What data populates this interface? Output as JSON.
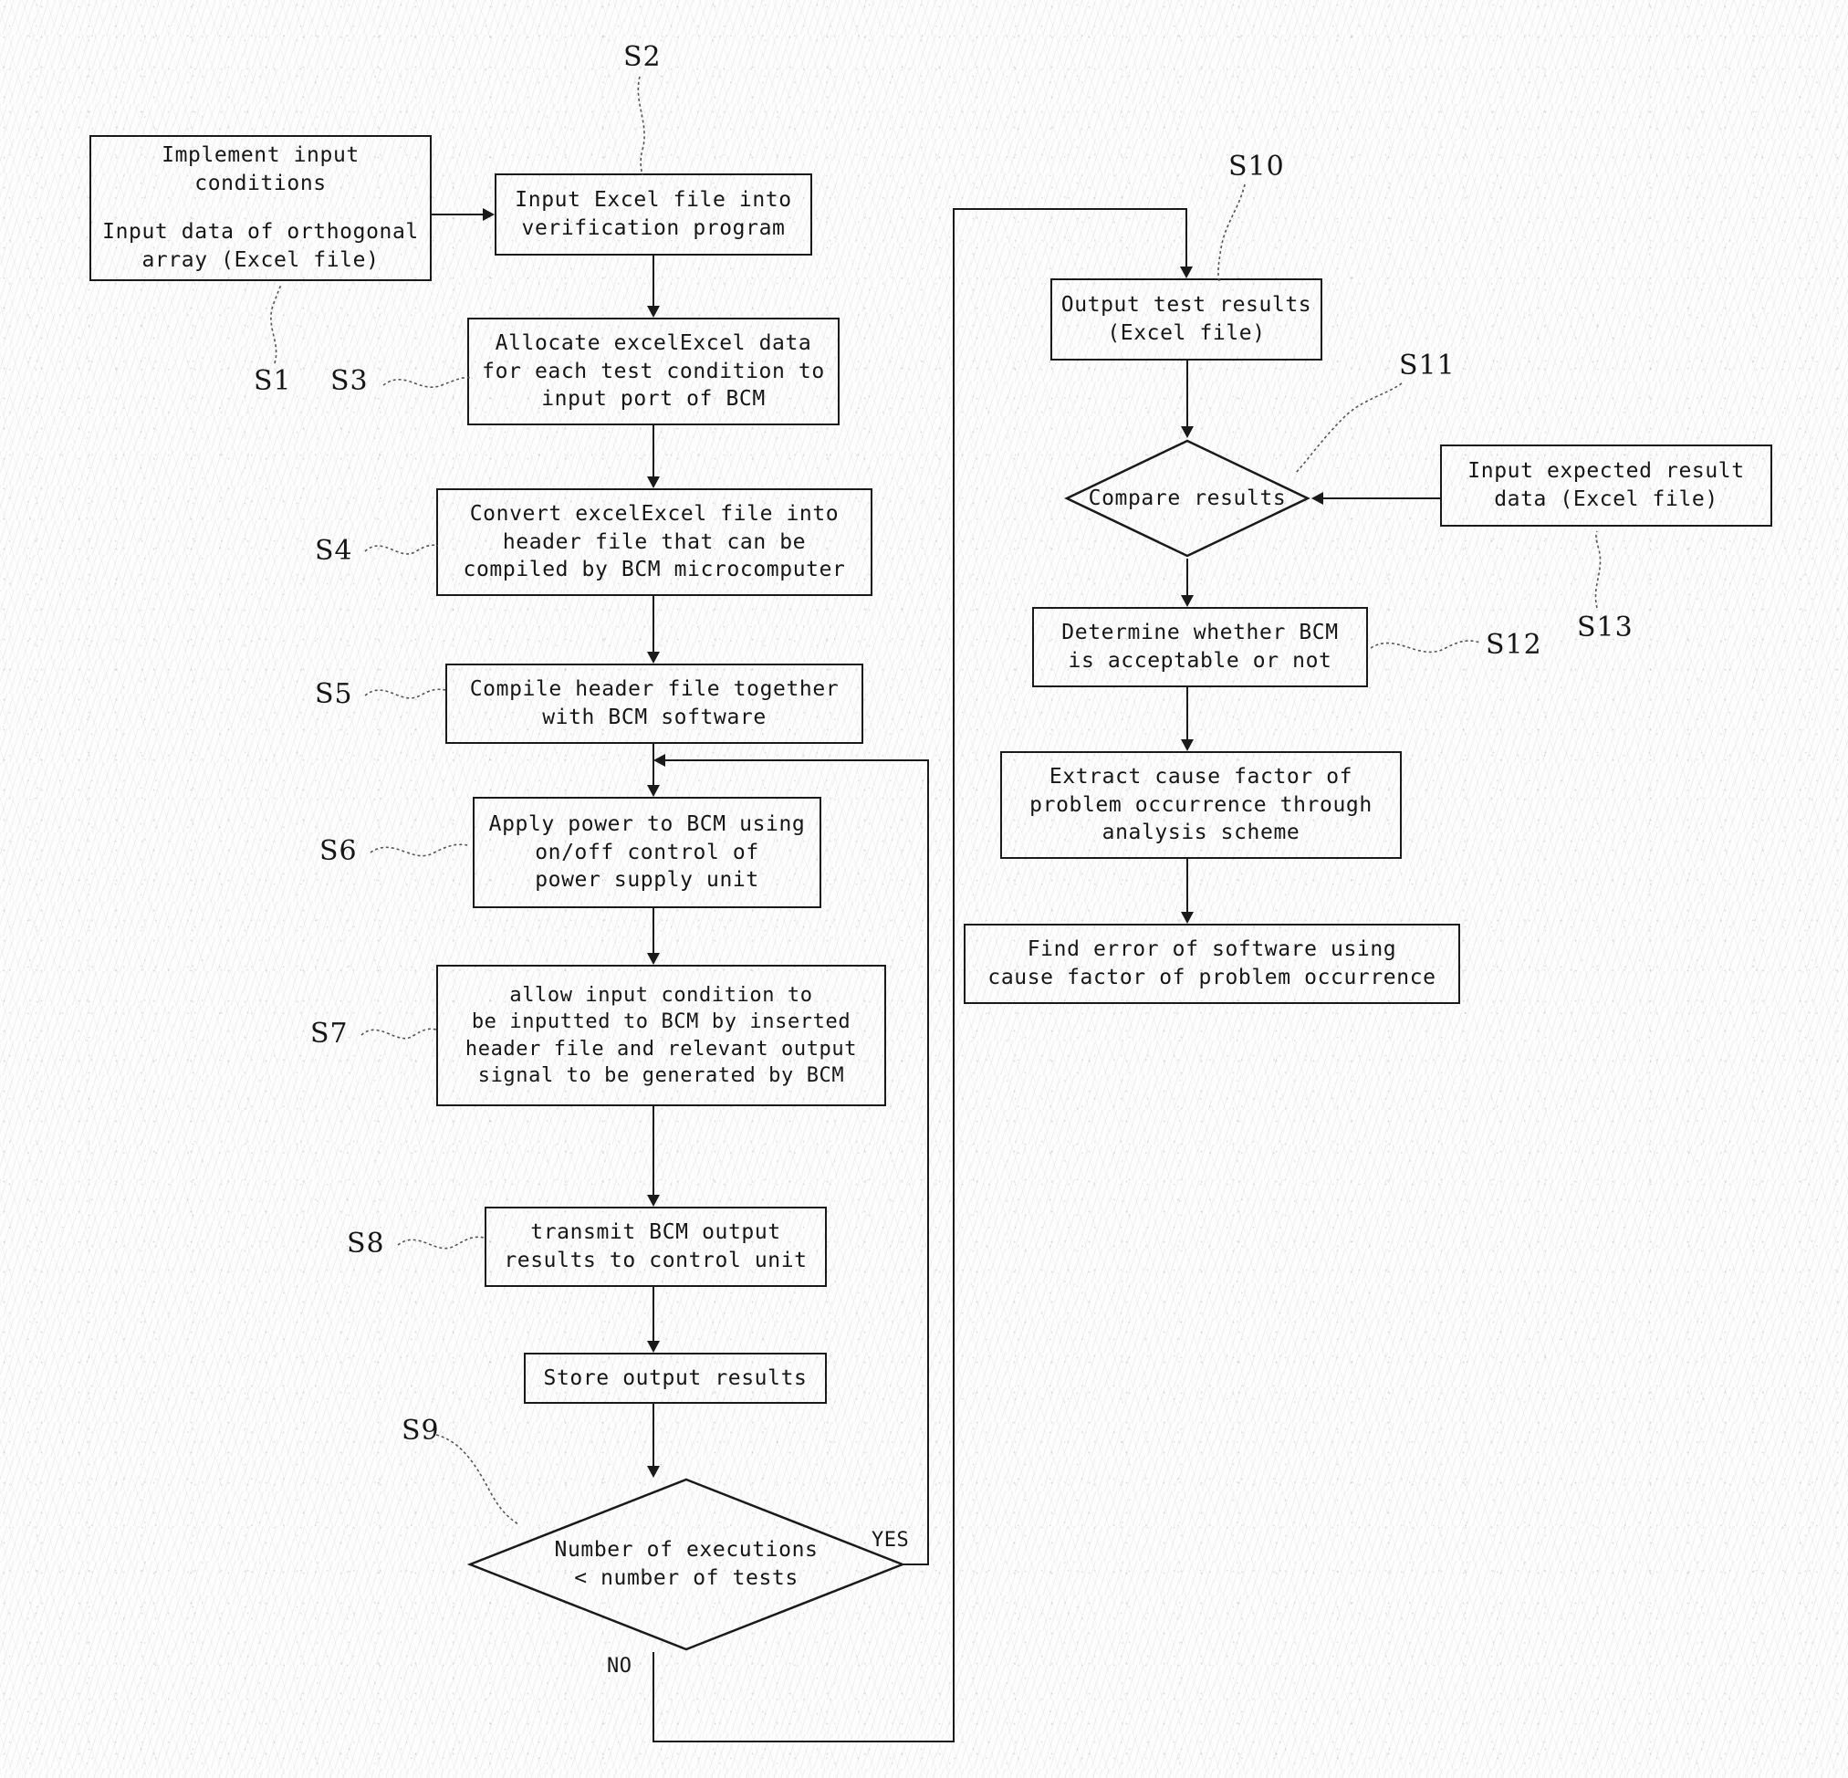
{
  "diagram": {
    "type": "flowchart",
    "title": "BCM software verification flowchart",
    "nodes": [
      {
        "id": "S1",
        "ref": "S1",
        "shape": "process",
        "lines": [
          "Implement input",
          "conditions",
          "",
          "Input data of orthogonal",
          "array (Excel file)"
        ]
      },
      {
        "id": "S2",
        "ref": "S2",
        "shape": "process",
        "lines": [
          "Input Excel file into",
          "verification program"
        ]
      },
      {
        "id": "S3",
        "ref": "S3",
        "shape": "process",
        "lines": [
          "Allocate excelExcel data",
          "for each test condition to",
          "input port of BCM"
        ]
      },
      {
        "id": "S4",
        "ref": "S4",
        "shape": "process",
        "lines": [
          "Convert excelExcel file into",
          "header file that can be",
          "compiled by BCM microcomputer"
        ]
      },
      {
        "id": "S5",
        "ref": "S5",
        "shape": "process",
        "lines": [
          "Compile header file together",
          "with BCM software"
        ]
      },
      {
        "id": "S6",
        "ref": "S6",
        "shape": "process",
        "lines": [
          "Apply power to BCM using",
          "on/off control of",
          "power supply unit"
        ]
      },
      {
        "id": "S7",
        "ref": "S7",
        "shape": "process",
        "lines": [
          "allow input condition to",
          "be inputted to BCM by inserted",
          "header file and relevant output",
          "signal to be generated by BCM"
        ]
      },
      {
        "id": "S8",
        "ref": "S8",
        "shape": "process",
        "lines": [
          "transmit BCM output",
          "results to control unit"
        ]
      },
      {
        "id": "STORE",
        "ref": "",
        "shape": "process",
        "lines": [
          "Store output results"
        ]
      },
      {
        "id": "S9",
        "ref": "S9",
        "shape": "decision",
        "lines": [
          "Number of executions",
          "< number of tests"
        ]
      },
      {
        "id": "S10",
        "ref": "S10",
        "shape": "process",
        "lines": [
          "Output test results",
          "(Excel file)"
        ]
      },
      {
        "id": "S11",
        "ref": "S11",
        "shape": "decision",
        "lines": [
          "Compare results"
        ]
      },
      {
        "id": "S13",
        "ref": "S13",
        "shape": "process",
        "lines": [
          "Input expected result",
          "data (Excel file)"
        ]
      },
      {
        "id": "S12",
        "ref": "S12",
        "shape": "process",
        "lines": [
          "Determine whether BCM",
          "is acceptable or not"
        ]
      },
      {
        "id": "EXTRACT",
        "ref": "",
        "shape": "process",
        "lines": [
          "Extract cause factor of",
          "problem occurrence through",
          "analysis scheme"
        ]
      },
      {
        "id": "FIND",
        "ref": "",
        "shape": "process",
        "lines": [
          "Find error of software using",
          "cause factor of problem occurrence"
        ]
      }
    ],
    "edge_labels": {
      "yes": "YES",
      "no": "NO"
    },
    "step_refs": {
      "s1": "S1",
      "s2": "S2",
      "s3": "S3",
      "s4": "S4",
      "s5": "S5",
      "s6": "S6",
      "s7": "S7",
      "s8": "S8",
      "s9": "S9",
      "s10": "S10",
      "s11": "S11",
      "s12": "S12",
      "s13": "S13"
    },
    "colors": {
      "stroke": "#1a1a1a",
      "text": "#161616",
      "background": "#fdfdfd"
    }
  }
}
